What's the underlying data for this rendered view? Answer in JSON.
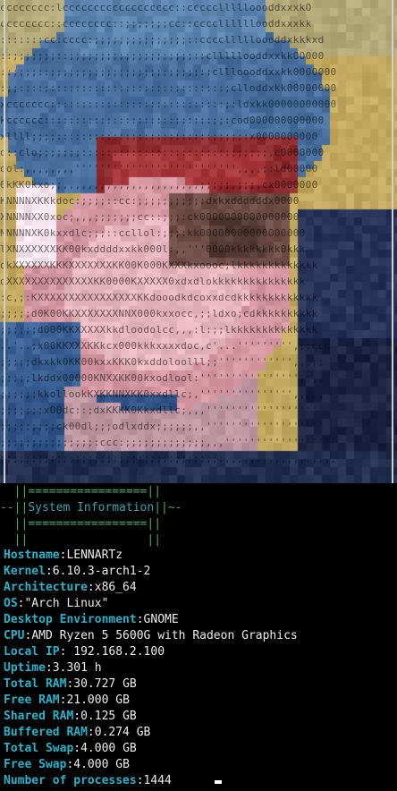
{
  "colors": {
    "background": "#000000",
    "key": "#24b4cc",
    "value": "#ececec",
    "banner_frame": "#3fae70",
    "banner_title": "#33a4b5"
  },
  "ascii_art": {
    "lines": [
      "cccccccc:lcccccccccccccccccc::cccccllllloooddxxxkO",
      "cccccccc::cccccccc::;;;;;;;cc::ccccllllllooddxxxkk",
      ":::::::cc:cccc:;;;;;;;;;;;;;;;::ccccllllloooddxkkkxd",
      "::;;;;;;;::;;;;;;;;;;;;;;;;;;;;::clllllooddxxkkOO000",
      "::;;;;::;;;;;;;;;;;;;;;;;;;;;;;;::cllloooddxxkk0000000",
      ":;;::::;::::::::::::::::::::::::::::;clloddxkk00000000",
      "xccccccc::::::::::::::::::::::::::::;:ldxkk00000000000",
      "kcccccc:::::::::::::::::::::::::::;;:cod000000000000",
      "xllll;;;;:::::::::::::::::::::::::;;;;;:x0000000000",
      "o::clo;;;;;;;::::::::::::::::::::::::;;;;;;,c0000000",
      "ool:,,,,,,,,'''''''''''''''''''''''''',,,,;:ld00000",
      "0kKK0kxo;;,,,,,,,,,,,,,,,,,,,,,,;;;;;,;;;,cx0000000",
      "KNNNNXKKkdoc:;;;;::cc:;;;;;;;;;;:dxkxddddddx0000",
      "XNNNNXX0xoc;,,,;;;;;;;cc::;;;:ck0000000000000000",
      "NNNNNXK0kxxdlc;;;::ccllol:;;;:kk00000000000000000",
      "lXNXXXXXXKK00kxddddxxkk000l:,,'''0000kkkkkkkk0kkk",
      "okXXXXXXKKKXXXXXXXKK00K000KXXXkxoooc;lkkkkkkkkkkkkk",
      "dXXXXXXXXXXXXXXKK0000KXXXXX0xdxdlokkkkkkkkkkkkkkk",
      ":c,;:KXXXXXXXXXXXXXXXXKKdooodkdcoxxdcdkkkkkkkkkkkkk",
      ";;;;;d0K00KKXXXXXXXNNX000kxxocc,;;ldxo;cdkkkkkkkkkk",
      ";;;;;;d000KKXXXXXkkdloodolcc,,,:l:;;lkkkkkkkkkkkkkk",
      "..'..;x00KKXXXKKkcx000kkkxxxxdoc,c'...''''''''',;;ccc",
      ";;;;;dkxkk0KK00kxxKKK0kxddoloolll;;'''''''''''',,,;;",
      ";;;;;lkddx00000KNXXKK00kxodlool:'''''''''''''''',,,,",
      ";;;;;;kkollookKXKKNNXKK0xxdllc;,''''''''''''''',,,,,",
      ";;;;;;;xO0dc::;dxKKKK0Kkxdllc;,,,'''''''''''''''''''",
      ";;;;;;;;;ck00dl;;;odlxddx;;;;;;,,'''''''''''''''''''",
      ";;;;;;;;;;;;;;;:ccc:;;;;;;;;;;;;;,,,''''''''''''''''''",
      ";;;;;;;;;;;;;;;;;;;;;;;;;;;;;;;;;;;;,,,,,,,,,,,,,,,,,,"
    ]
  },
  "banner": {
    "line1_left": "  ||",
    "line1_rule": "=================",
    "line1_right": "||",
    "line2_left": "--||",
    "title": "System Information",
    "line2_right": "||~-",
    "line3_left": "  ||",
    "line3_rule": "=================",
    "line3_right": "||",
    "line4_left": "  ||",
    "line4_space": "                 ",
    "line4_right": "||"
  },
  "system_info": [
    {
      "key": "Hostname",
      "sep": ":",
      "value": "LENNARTz"
    },
    {
      "key": "Kernel",
      "sep": ":",
      "value": "6.10.3-arch1-2"
    },
    {
      "key": "Architecture",
      "sep": ":",
      "value": "x86_64"
    },
    {
      "key": "OS",
      "sep": ":",
      "value": "\"Arch Linux\""
    },
    {
      "key": "Desktop Environment",
      "sep": ":",
      "value": "GNOME"
    },
    {
      "key": "CPU",
      "sep": ":",
      "value": "AMD Ryzen 5 5600G with Radeon Graphics"
    },
    {
      "key": "Local IP",
      "sep": ": ",
      "value": "192.168.2.100"
    },
    {
      "key": "Uptime",
      "sep": ":",
      "value": "3.301 h"
    },
    {
      "key": "Total RAM",
      "sep": ":",
      "value": "30.727 GB"
    },
    {
      "key": "Free RAM",
      "sep": ":",
      "value": "21.000 GB"
    },
    {
      "key": "Shared RAM",
      "sep": ":",
      "value": "0.125 GB"
    },
    {
      "key": "Buffered RAM",
      "sep": ":",
      "value": "0.274 GB"
    },
    {
      "key": "Total Swap",
      "sep": ":",
      "value": "4.000 GB"
    },
    {
      "key": "Free Swap",
      "sep": ":",
      "value": "4.000 GB"
    },
    {
      "key": "Number of processes",
      "sep": ":",
      "value": "1444"
    }
  ]
}
